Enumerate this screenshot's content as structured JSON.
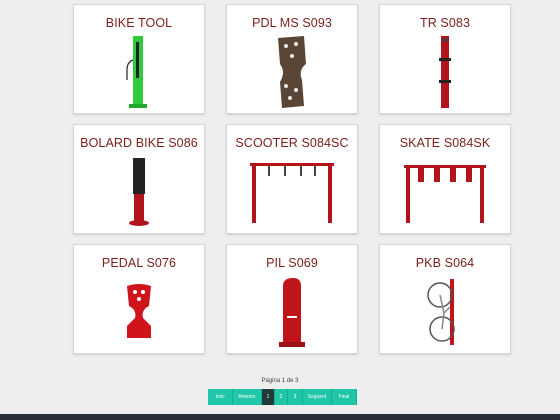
{
  "products": [
    {
      "name": "BIKE TOOL",
      "icon": "bike-tool-stand-icon",
      "color": "#2ecc3a"
    },
    {
      "name": "PDL MS S093",
      "icon": "pdl-stand-icon",
      "color": "#5a4636"
    },
    {
      "name": "TR S083",
      "icon": "tr-rack-icon",
      "color": "#b3141b"
    },
    {
      "name": "BOLARD BIKE S086",
      "icon": "bollard-icon",
      "color": "#b3141b"
    },
    {
      "name": "SCOOTER S084SC",
      "icon": "scooter-rack-icon",
      "color": "#b3141b"
    },
    {
      "name": "SKATE S084SK",
      "icon": "skate-rack-icon",
      "color": "#b3141b"
    },
    {
      "name": "PEDAL S076",
      "icon": "pedal-stand-icon",
      "color": "#d0141b"
    },
    {
      "name": "PIL S069",
      "icon": "pil-totem-icon",
      "color": "#c0141b"
    },
    {
      "name": "PKB S064",
      "icon": "vertical-bike-hanger-icon",
      "color": "#c0141b"
    }
  ],
  "pagination": {
    "info": "Página 1 de 3",
    "first": "Inici",
    "prev": "Anterior",
    "pages": [
      "1",
      "2",
      "3"
    ],
    "next": "Següent",
    "last": "Final",
    "current_page": 1
  }
}
